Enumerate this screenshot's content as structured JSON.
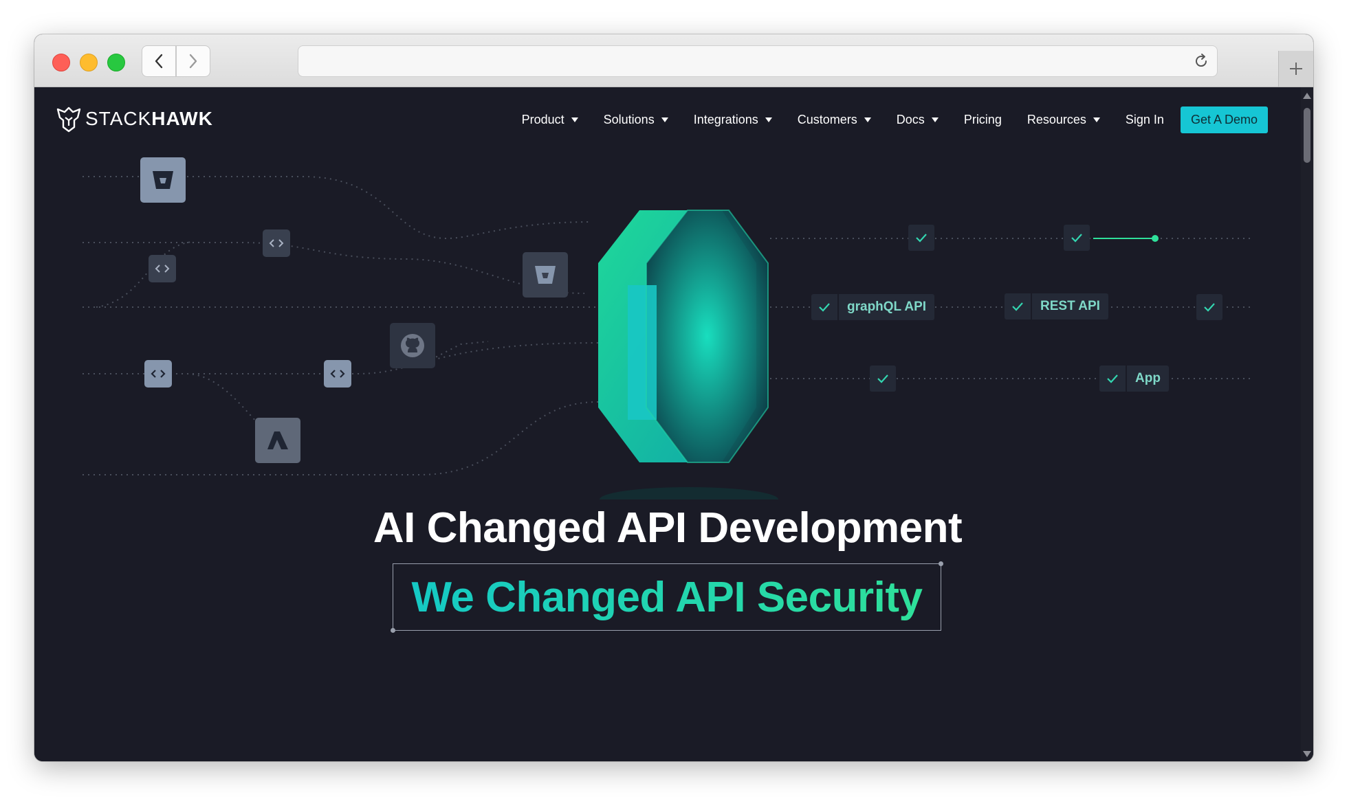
{
  "browser": {
    "url": "",
    "new_tab_icon": "plus-icon",
    "reload_icon": "reload-icon"
  },
  "site": {
    "logo": {
      "word_light": "STACK",
      "word_bold": "HAWK",
      "icon": "hawk-icon"
    },
    "nav": {
      "items": [
        {
          "label": "Product",
          "has_dropdown": true
        },
        {
          "label": "Solutions",
          "has_dropdown": true
        },
        {
          "label": "Integrations",
          "has_dropdown": true
        },
        {
          "label": "Customers",
          "has_dropdown": true
        },
        {
          "label": "Docs",
          "has_dropdown": true
        },
        {
          "label": "Pricing",
          "has_dropdown": false
        },
        {
          "label": "Resources",
          "has_dropdown": true
        },
        {
          "label": "Sign In",
          "has_dropdown": false
        }
      ],
      "cta": "Get A Demo"
    },
    "illustration": {
      "labels": [
        "graphQL API",
        "REST API",
        "App"
      ],
      "source_icons": [
        "bitbucket-icon",
        "code-icon",
        "github-icon",
        "azure-icon"
      ]
    },
    "hero": {
      "title": "AI Changed API Development",
      "subtitle": "We Changed API Security"
    },
    "colors": {
      "background": "#1a1b26",
      "accent": "#16c6d4",
      "gradient_start": "#15c9c4",
      "gradient_end": "#2fe09a"
    }
  }
}
